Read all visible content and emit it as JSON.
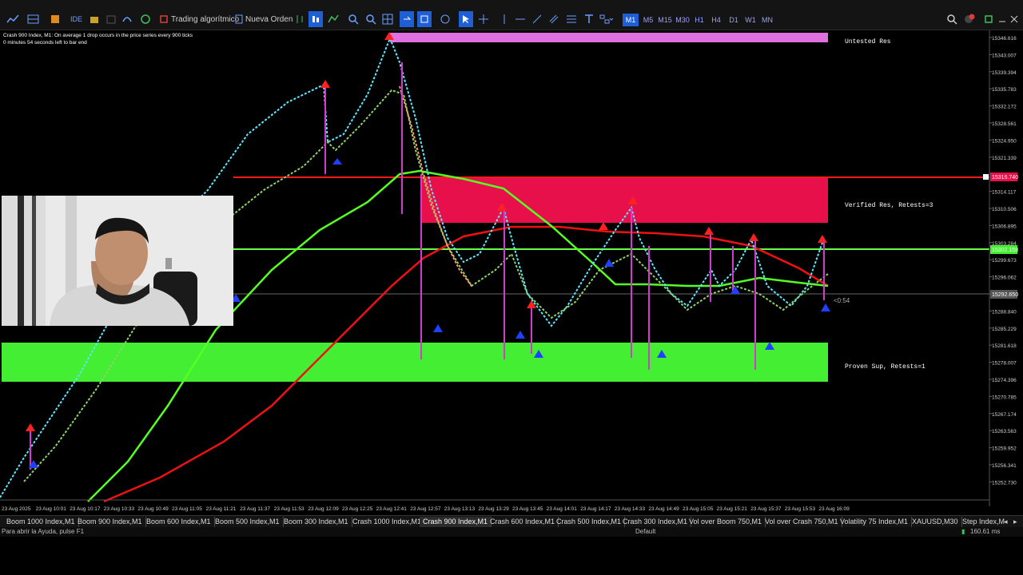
{
  "toolbar": {
    "algo_trading": "Trading algorítmico",
    "new_order": "Nueva Orden",
    "timeframes": [
      "M1",
      "M5",
      "M15",
      "M30",
      "H1",
      "H4",
      "D1",
      "W1",
      "MN"
    ],
    "active_timeframe": "M1"
  },
  "chart": {
    "header_line1": "Crash 900 Index, M1:  On average 1 drop occurs in the price series every 900 ticks",
    "header_line2": "0 minutes 54 seconds left to bar end",
    "zones": {
      "untested": "Untested Res",
      "verified": "Verified Res, Retests=3",
      "proven": "Proven Sup, Retests=1"
    },
    "countdown": "<0:54",
    "price_labels": [
      "15346.616",
      "15343.007",
      "15339.394",
      "15335.783",
      "15332.172",
      "15328.561",
      "15324.950",
      "15321.339",
      "15317.728",
      "15314.117",
      "15310.506",
      "15306.895",
      "15303.284",
      "15299.673",
      "15296.062",
      "15292.451",
      "15288.840",
      "15285.229",
      "15281.618",
      "15278.007",
      "15274.396",
      "15270.785",
      "15267.174",
      "15263.563",
      "15259.952",
      "15256.341",
      "15252.730"
    ],
    "current_price_labels": [
      "15316.740",
      "15302.158",
      "15292.650"
    ],
    "time_labels": [
      "23 Aug 2025",
      "23 Aug 10:01",
      "23 Aug 10:17",
      "23 Aug 10:33",
      "23 Aug 10:49",
      "23 Aug 11:05",
      "23 Aug 11:21",
      "23 Aug 11:37",
      "23 Aug 11:53",
      "23 Aug 12:09",
      "23 Aug 12:25",
      "23 Aug 12:41",
      "23 Aug 12:57",
      "23 Aug 13:13",
      "23 Aug 13:29",
      "23 Aug 13:45",
      "23 Aug 14:01",
      "23 Aug 14:17",
      "23 Aug 14:33",
      "23 Aug 14:49",
      "23 Aug 15:05",
      "23 Aug 15:21",
      "23 Aug 15:37",
      "23 Aug 15:53",
      "23 Aug 16:09"
    ],
    "colors": {
      "untested_zone": "#e070e0",
      "resistance_zone": "#e8104a",
      "support_zone": "#44ee33",
      "fast_ma": "#55ff22",
      "slow_ma": "#ee1111"
    }
  },
  "tabs": [
    "Boom 1000 Index,M1",
    "Boom 900 Index,M1",
    "Boom 600 Index,M1",
    "Boom 500 Index,M1",
    "Boom 300 Index,M1",
    "Crash 1000 Index,M1",
    "Crash 900 Index,M1",
    "Crash 600 Index,M1",
    "Crash 500 Index,M1",
    "Crash 300 Index,M1",
    "Vol over Boom 750,M1",
    "Vol over Crash 750,M1",
    "Volatility 75 Index,M1",
    "XAUUSD,M30",
    "Step Index,M"
  ],
  "active_tab": "Crash 900 Index,M1",
  "status": {
    "help": "Para abrir la Ayuda, pulse F1",
    "profile": "Default",
    "ping": "160.61 ms"
  }
}
